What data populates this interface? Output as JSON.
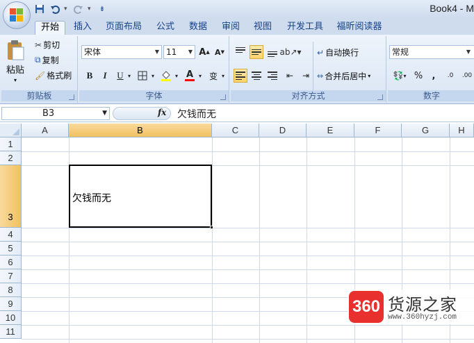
{
  "window": {
    "title": "Book4 - M"
  },
  "qat": {
    "icons": [
      "save-icon",
      "undo-icon",
      "redo-icon",
      "customize-icon"
    ]
  },
  "tabs": [
    "开始",
    "插入",
    "页面布局",
    "公式",
    "数据",
    "审阅",
    "视图",
    "开发工具",
    "福昕阅读器"
  ],
  "ribbon": {
    "clipboard": {
      "paste": "粘贴",
      "cut": "剪切",
      "copy": "复制",
      "format_painter": "格式刷",
      "label": "剪贴板"
    },
    "font": {
      "name": "宋体",
      "size": "11",
      "bold": "B",
      "italic": "I",
      "underline": "U",
      "grow": "A",
      "shrink": "A",
      "font_color": "A",
      "phonetic": "变",
      "label": "字体"
    },
    "alignment": {
      "wrap_text": "自动换行",
      "merge_center": "合并后居中",
      "label": "对齐方式"
    },
    "number": {
      "format": "常规",
      "percent": "%",
      "comma": ",",
      "inc_decimal": ".0",
      "dec_decimal": ".00",
      "label": "数字"
    }
  },
  "formula_bar": {
    "name_box": "B3",
    "fx": "fx",
    "content": "欠钱而无"
  },
  "sheet": {
    "columns": [
      "A",
      "B",
      "C",
      "D",
      "E",
      "F",
      "G",
      "H"
    ],
    "rows": [
      "1",
      "2",
      "3",
      "4",
      "5",
      "6",
      "7",
      "8",
      "9",
      "10",
      "11"
    ],
    "selected_cell": "B3",
    "cell_B3": "欠钱而无"
  },
  "watermark": {
    "badge": "360",
    "name": "货源之家",
    "url": "www.360hyzj.com"
  }
}
